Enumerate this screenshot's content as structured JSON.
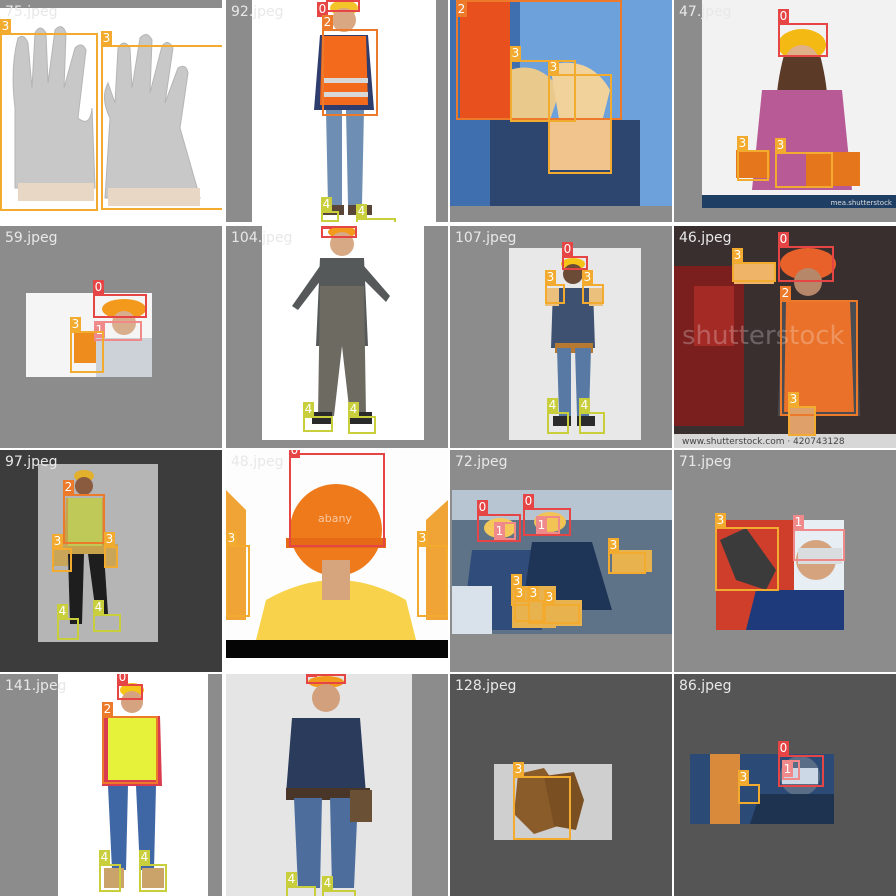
{
  "grid": {
    "tiles": [
      {
        "name": "75.jpeg",
        "labels": [
          "3",
          "3"
        ]
      },
      {
        "name": "92.jpeg",
        "labels": [
          "0",
          "2",
          "4",
          "4"
        ]
      },
      {
        "name": "",
        "labels": [
          "2",
          "3",
          "3"
        ]
      },
      {
        "name": "47.jpeg",
        "labels": [
          "0",
          "3",
          "3"
        ]
      },
      {
        "name": "59.jpeg",
        "labels": [
          "0",
          "1",
          "3"
        ]
      },
      {
        "name": "104.jpeg",
        "labels": [
          "0",
          "4",
          "4"
        ]
      },
      {
        "name": "107.jpeg",
        "labels": [
          "0",
          "3",
          "3",
          "4",
          "4"
        ]
      },
      {
        "name": "46.jpeg",
        "labels": [
          "0",
          "3",
          "2",
          "3"
        ]
      },
      {
        "name": "97.jpeg",
        "labels": [
          "2",
          "3",
          "3",
          "4",
          "4"
        ]
      },
      {
        "name": "48.jpeg",
        "labels": [
          "0",
          "3",
          "3"
        ]
      },
      {
        "name": "72.jpeg",
        "labels": [
          "0",
          "0",
          "1",
          "1",
          "3",
          "3",
          "3",
          "3",
          "3"
        ]
      },
      {
        "name": "71.jpeg",
        "labels": [
          "3",
          "1"
        ]
      },
      {
        "name": "141.jpeg",
        "labels": [
          "0",
          "2",
          "4",
          "4"
        ]
      },
      {
        "name": "",
        "labels": [
          "0",
          "4",
          "4"
        ]
      },
      {
        "name": "128.jpeg",
        "labels": [
          "3"
        ]
      },
      {
        "name": "86.jpeg",
        "labels": [
          "0",
          "1",
          "3"
        ]
      }
    ],
    "watermarks": {
      "t47": "mea.shutterstock",
      "t46": "www.shutterstock.com · 420743128",
      "t46_center": "shutterstock",
      "t48_helmet": "abany"
    }
  }
}
